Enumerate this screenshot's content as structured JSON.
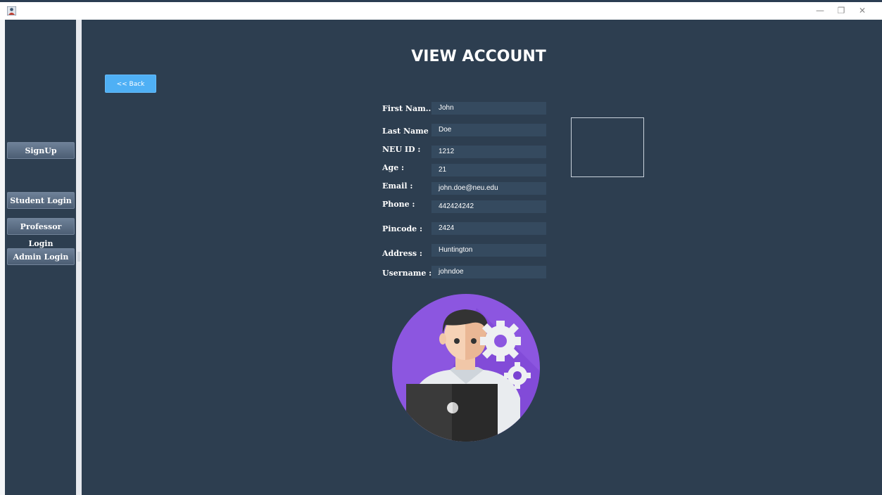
{
  "window": {
    "controls": {
      "minimize": "—",
      "restore": "❐",
      "close": "✕"
    }
  },
  "sidebar": {
    "buttons": [
      {
        "label": "SignUp"
      },
      {
        "label": "Student Login"
      },
      {
        "label": "Professor Login"
      },
      {
        "label": "Admin Login"
      }
    ]
  },
  "content": {
    "title": "VIEW ACCOUNT",
    "back_label": "<< Back",
    "fields": [
      {
        "label": "First Nam...",
        "value": "John"
      },
      {
        "label": "Last Name :",
        "value": "Doe"
      },
      {
        "label": "NEU ID :",
        "value": "1212"
      },
      {
        "label": "Age :",
        "value": "21"
      },
      {
        "label": "Email :",
        "value": "john.doe@neu.edu"
      },
      {
        "label": "Phone :",
        "value": "442424242"
      },
      {
        "label": "Pincode :",
        "value": "2424"
      },
      {
        "label": "Address :",
        "value": "Huntington"
      },
      {
        "label": "Username :",
        "value": "johndoe"
      }
    ]
  },
  "colors": {
    "background": "#2d3e50",
    "field_bg": "#354a5f",
    "back_button": "#4fb0f5",
    "avatar_circle": "#8c56e0"
  },
  "icons": {
    "app": "app-icon",
    "avatar": "developer-avatar-icon",
    "gears": "gear-icon"
  }
}
